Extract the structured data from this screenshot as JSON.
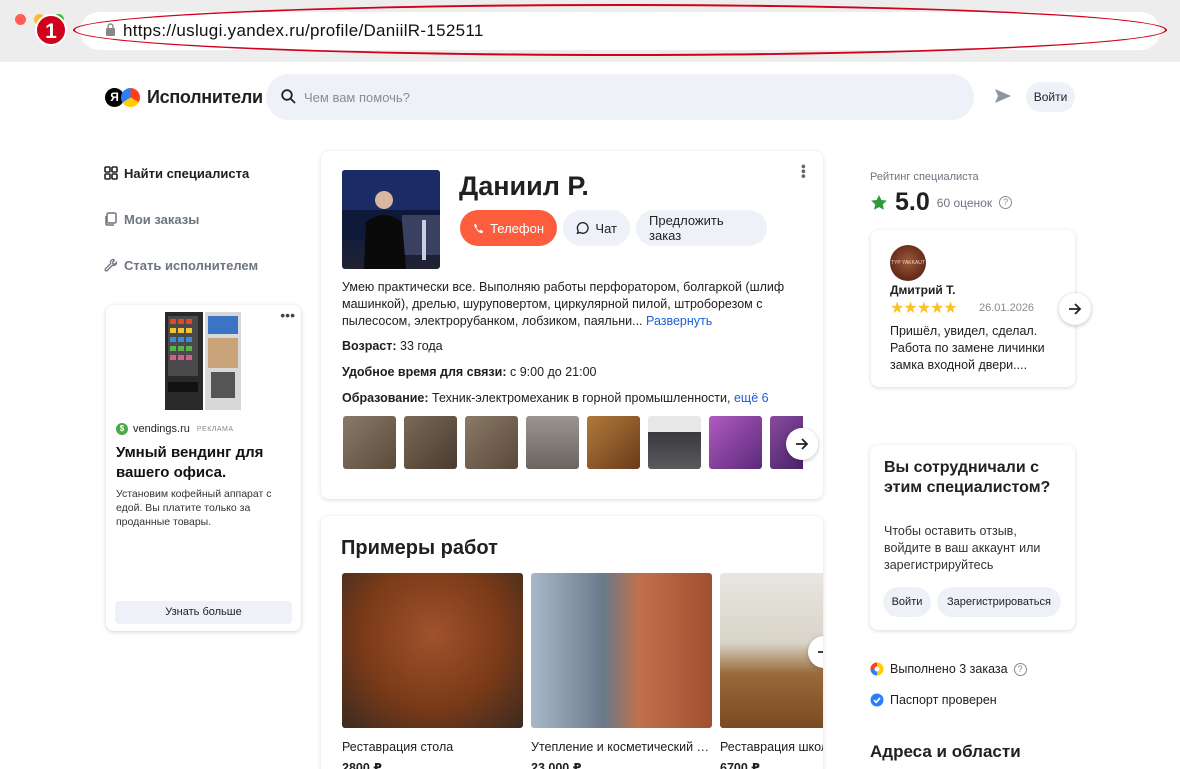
{
  "browser": {
    "url": "https://uslugi.yandex.ru/profile/DaniilR-152511",
    "annotation_number": "1",
    "dot_colors": [
      "#ff5f57",
      "#febc2e",
      "#28c840"
    ]
  },
  "header": {
    "logo_text": "Исполнители",
    "search_placeholder": "Чем вам помочь?",
    "login_label": "Войти"
  },
  "sidebar": {
    "items": [
      {
        "label": "Найти специалиста",
        "icon": "grid-icon",
        "active": true
      },
      {
        "label": "Мои заказы",
        "icon": "orders-icon",
        "active": false
      },
      {
        "label": "Стать исполнителем",
        "icon": "wrench-icon",
        "active": false
      }
    ]
  },
  "ad": {
    "source": "vendings.ru",
    "source_tag": "РЕКЛАМА",
    "title": "Умный вендинг для вашего офиса.",
    "description": "Установим кофейный аппарат с едой. Вы платите только за проданные товары.",
    "button": "Узнать больше"
  },
  "profile": {
    "name": "Даниил Р.",
    "buttons": {
      "phone": "Телефон",
      "chat": "Чат",
      "offer": "Предложить заказ"
    },
    "description": "Умею практически все. Выполняю работы перфоратором, болгаркой (шлиф машинкой), дрелью, шуруповертом, циркулярной пилой, штроборезом с пылесосом, электрорубанком, лобзиком, паяльни...",
    "expand_link": "Развернуть",
    "age_label": "Возраст:",
    "age_value": "33 года",
    "contact_label": "Удобное время для связи:",
    "contact_value": "с 9:00 до 21:00",
    "education_label": "Образование:",
    "education_value": "Техник-электромеханик в горной промышленности,",
    "education_more": "ещё 6",
    "thumb_colors": [
      "#7a6a5a",
      "#5d4c3d",
      "#6f5c48",
      "#8a8580",
      "#8c5a2e",
      "#5a5a5e",
      "#9a4aa8",
      "#6a3f8a"
    ]
  },
  "works": {
    "title": "Примеры работ",
    "items": [
      {
        "label": "Реставрация стола",
        "price": "2800 ₽",
        "color": "#8b4513"
      },
      {
        "label": "Утепление и косметический ремонт",
        "price": "23 000 ₽",
        "color": "#7a6050"
      },
      {
        "label": "Реставрация школьной мебели",
        "price": "6700 ₽",
        "color": "#8a6a4a"
      }
    ]
  },
  "rating": {
    "label": "Рейтинг специалиста",
    "value": "5.0",
    "count": "60 оценок"
  },
  "review": {
    "author": "Дмитрий Т.",
    "stars": 5,
    "stars_text": "★★★★★",
    "date": "26.01.2026",
    "text": "Пришёл, увидел, сделал. Работа по замене личинки замка входной двери....",
    "avatar_text": "TYP YAKKAUT"
  },
  "cooperation": {
    "title": "Вы сотрудничали с этим специалистом?",
    "description": "Чтобы оставить отзыв, войдите в ваш аккаунт или зарегистрируйтесь",
    "login": "Войти",
    "register": "Зарегистрироваться"
  },
  "stats": {
    "orders_done": "Выполнено 3 заказа",
    "passport": "Паспорт проверен"
  },
  "addresses": {
    "title": "Адреса и области"
  }
}
